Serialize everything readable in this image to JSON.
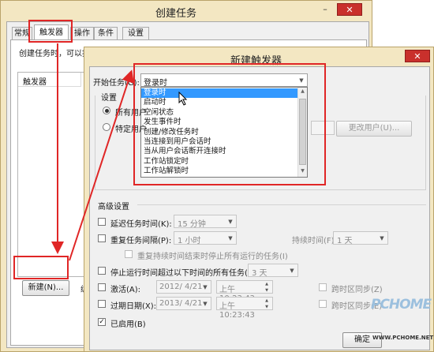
{
  "parent_window": {
    "title": "创建任务",
    "tabs": [
      "常规",
      "触发器",
      "操作",
      "条件",
      "设置"
    ],
    "description": "创建任务时，可以指定触发任务的条件。",
    "list_header": "触发器",
    "new_button": "新建(N)...",
    "edit_button_partial": "编"
  },
  "dialog": {
    "title": "新建触发器",
    "start_task_label": "开始任务(G):",
    "start_task_value": "登录时",
    "dropdown_options": [
      "登录时",
      "启动时",
      "空闲状态",
      "发生事件时",
      "创建/修改任务时",
      "当连接到用户会话时",
      "当从用户会话断开连接时",
      "工作站锁定时",
      "工作站解锁时"
    ],
    "selected_index": 0,
    "settings_label": "设置",
    "radio_any_user": "所有用户",
    "radio_specific_user": "特定用户",
    "change_user_button": "更改用户(U)...",
    "advanced_label": "高级设置",
    "delay_label": "延迟任务时间(K):",
    "delay_value": "15 分钟",
    "repeat_label": "重复任务间隔(P):",
    "repeat_value": "1 小时",
    "duration_label": "持续时间(F):",
    "duration_value": "1 天",
    "stop_repeat_label": "重复持续时间结束时停止所有运行的任务(I)",
    "stop_if_longer_label": "停止运行时间超过以下时间的所有任务(L):",
    "stop_if_longer_value": "3 天",
    "activate_label": "激活(A):",
    "activate_date": "2012/ 4/21",
    "activate_time": "上午 10:23:43",
    "expire_label": "过期日期(X):",
    "expire_date": "2013/ 4/21",
    "expire_time": "上午 10:23:43",
    "sync_timezone_label_1": "跨时区同步(Z)",
    "sync_timezone_label_2": "跨时区同步(E)",
    "enabled_label": "已启用(B)",
    "enabled_checked": true,
    "ok_button_partial": "确定"
  },
  "watermark": {
    "brand": "PCHOME",
    "url": "WWW.PCHOME.NET"
  },
  "colors": {
    "annotation_red": "#e02626",
    "highlight_blue": "#3399ff",
    "frame": "#f3e7c2"
  }
}
